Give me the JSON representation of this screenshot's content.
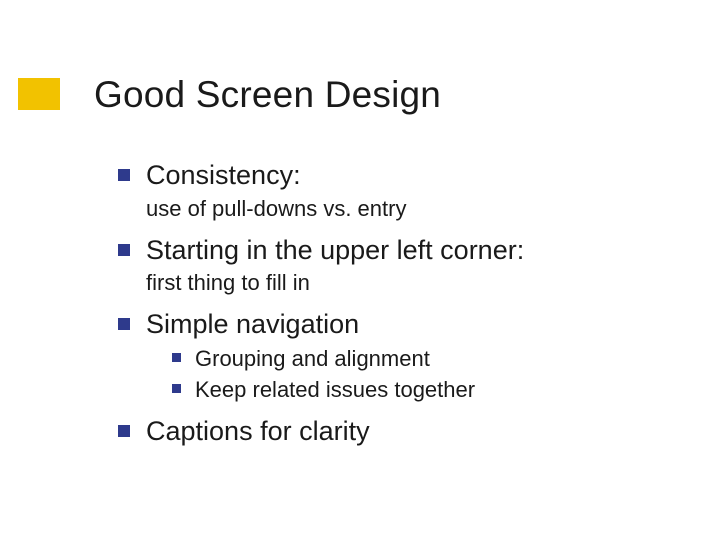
{
  "accent_color": "#f2c200",
  "bullet_color": "#2e3a8c",
  "title": "Good Screen Design",
  "items": [
    {
      "text": "Consistency:",
      "sub": "use of pull-downs vs. entry"
    },
    {
      "text": "Starting in the upper left corner:",
      "sub": "first thing to fill in"
    },
    {
      "text": "Simple navigation",
      "children": [
        {
          "text": "Grouping and alignment"
        },
        {
          "text": "Keep related issues together"
        }
      ]
    },
    {
      "text": "Captions for clarity"
    }
  ]
}
